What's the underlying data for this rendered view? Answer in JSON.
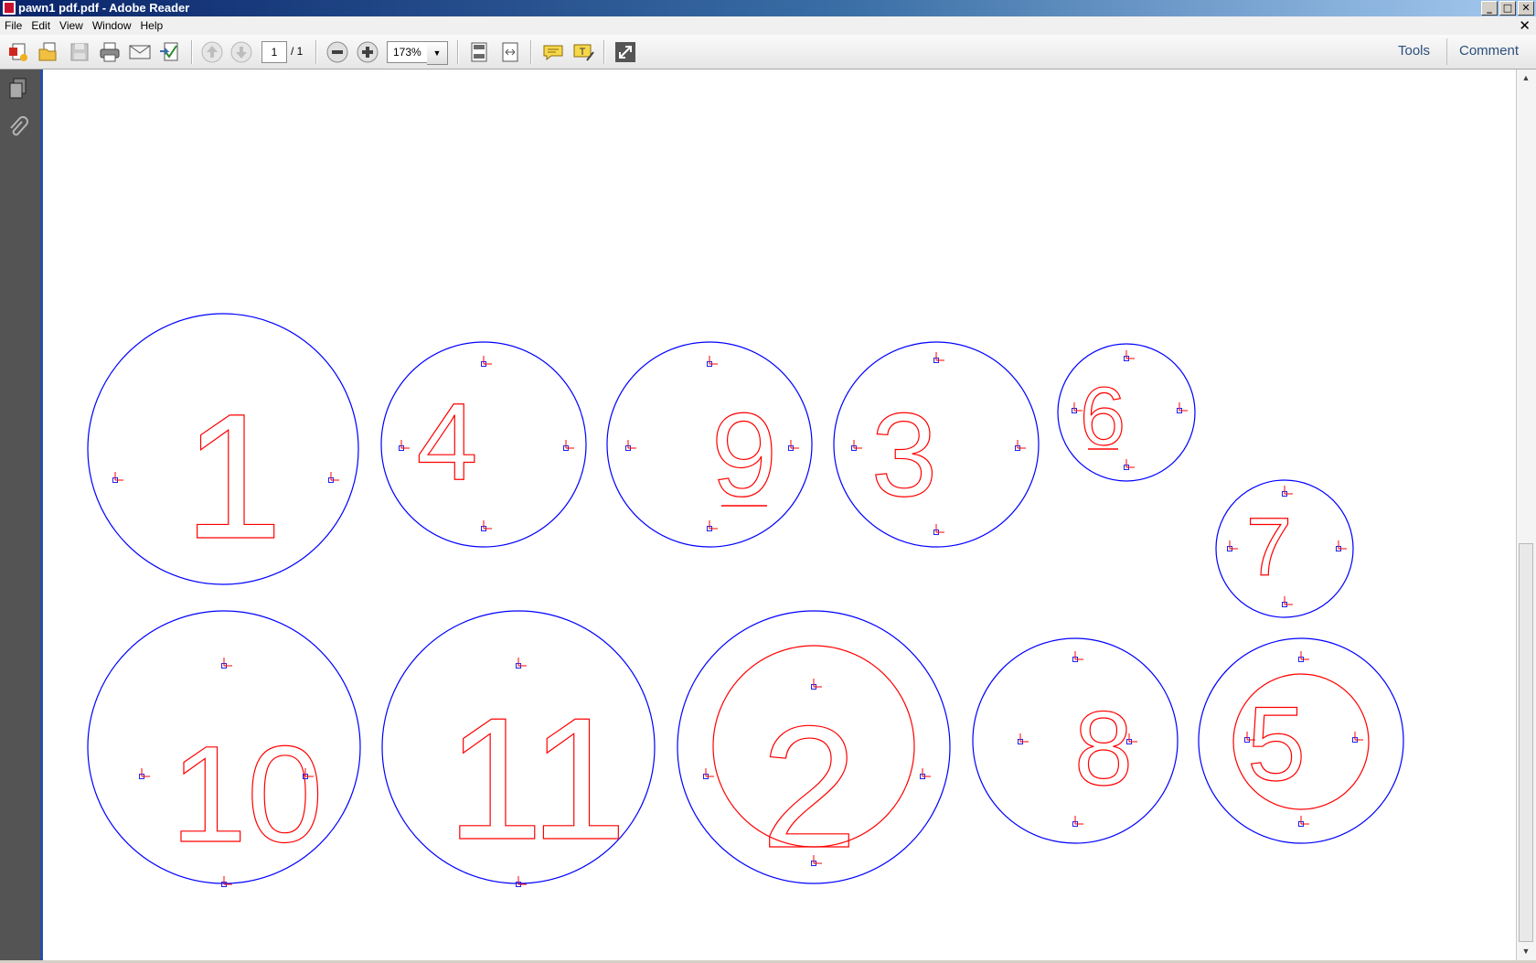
{
  "window": {
    "title": "pawn1 pdf.pdf - Adobe Reader"
  },
  "window_controls": {
    "minimize": "_",
    "maximize": "□",
    "close": "✕"
  },
  "menu": [
    "File",
    "Edit",
    "View",
    "Window",
    "Help"
  ],
  "menu_close": "✕",
  "toolbar": {
    "page_current": "1",
    "page_total": "/ 1",
    "zoom": "173%",
    "tools_label": "Tools",
    "comment_label": "Comment"
  },
  "document": {
    "pieces": [
      {
        "number": "1"
      },
      {
        "number": "4"
      },
      {
        "number": "9"
      },
      {
        "number": "3"
      },
      {
        "number": "6"
      },
      {
        "number": "7"
      },
      {
        "number": "10"
      },
      {
        "number": "11"
      },
      {
        "number": "2"
      },
      {
        "number": "8"
      },
      {
        "number": "5"
      }
    ]
  },
  "colors": {
    "outline": "#0000ff",
    "engrave": "#ff0000",
    "panel": "#545454",
    "link": "#2b4f7c"
  }
}
